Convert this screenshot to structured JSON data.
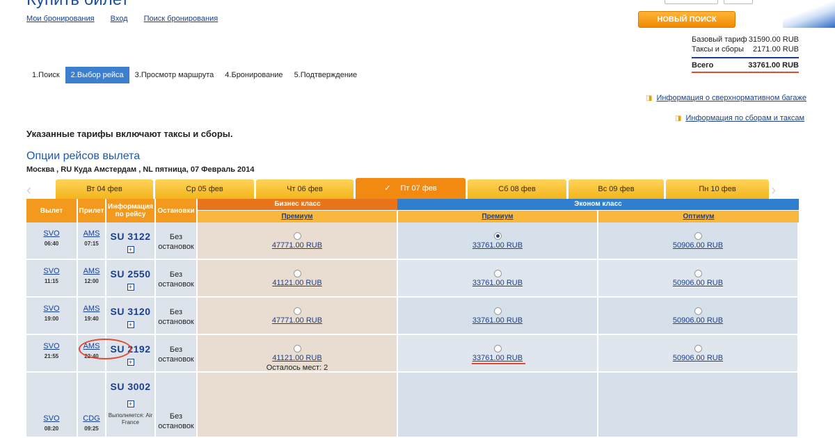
{
  "header": {
    "title": "Купить билет",
    "links": [
      "Мои бронирования",
      "Вход",
      "Поиск бронирования"
    ],
    "new_search": "НОВЫЙ ПОИСК"
  },
  "prices": {
    "base_label": "Базовый тариф",
    "base_value": "31590.00 RUB",
    "tax_label": "Таксы и сборы",
    "tax_value": "2171.00 RUB",
    "total_label": "Всего",
    "total_value": "33761.00 RUB"
  },
  "steps": [
    "1.Поиск",
    "2.Выбор рейса",
    "3.Просмотр маршрута",
    "4.Бронирование",
    "5.Подтверждение"
  ],
  "info_links": {
    "baggage": "Информация о сверхнормативном багаже",
    "taxes": "Информация по сборам и таксам"
  },
  "note": "Указанные тарифы включают таксы и сборы.",
  "section_title": "Опции рейсов вылета",
  "route": "Москва , RU Куда Амстердам , NL пятница, 07 Февраль 2014",
  "date_tabs": [
    "Вт 04 фев",
    "Ср 05 фев",
    "Чт 06 фев",
    "Пт 07 фев",
    "Сб 08 фев",
    "Вс 09 фев",
    "Пн 10 фев"
  ],
  "columns": {
    "dep": "Вылет",
    "arr": "Прилет",
    "info": "Информация по рейсу",
    "stops": "Остановки",
    "business": "Бизнес класс",
    "economy": "Эконом класс",
    "premium": "Премиум",
    "premium2": "Премиум",
    "optimum": "Оптимум"
  },
  "flights": [
    {
      "from": "SVO",
      "dep": "06:40",
      "to": "AMS",
      "arr": "07:15",
      "num": "SU 3122",
      "stops": "Без остановок",
      "biz": "47771.00 RUB",
      "eco": "33761.00 RUB",
      "opt": "50906.00 RUB"
    },
    {
      "from": "SVO",
      "dep": "11:15",
      "to": "AMS",
      "arr": "12:00",
      "num": "SU 2550",
      "stops": "Без остановок",
      "biz": "41121.00 RUB",
      "eco": "33761.00 RUB",
      "opt": "50906.00 RUB"
    },
    {
      "from": "SVO",
      "dep": "19:00",
      "to": "AMS",
      "arr": "19:40",
      "num": "SU 3120",
      "stops": "Без остановок",
      "biz": "47771.00 RUB",
      "eco": "33761.00 RUB",
      "opt": "50906.00 RUB"
    },
    {
      "from": "SVO",
      "dep": "21:55",
      "to": "AMS",
      "arr": "22:40",
      "num": "SU 2192",
      "stops": "Без остановок",
      "biz": "41121.00 RUB",
      "seats": "Осталось мест: 2",
      "eco": "33761.00 RUB",
      "opt": "50906.00 RUB"
    },
    {
      "from": "SVO",
      "dep": "08:20",
      "to": "CDG",
      "arr": "09:25",
      "num": "SU 3002",
      "stops": "Без остановок",
      "operated": "Выполняется: Air France"
    }
  ]
}
